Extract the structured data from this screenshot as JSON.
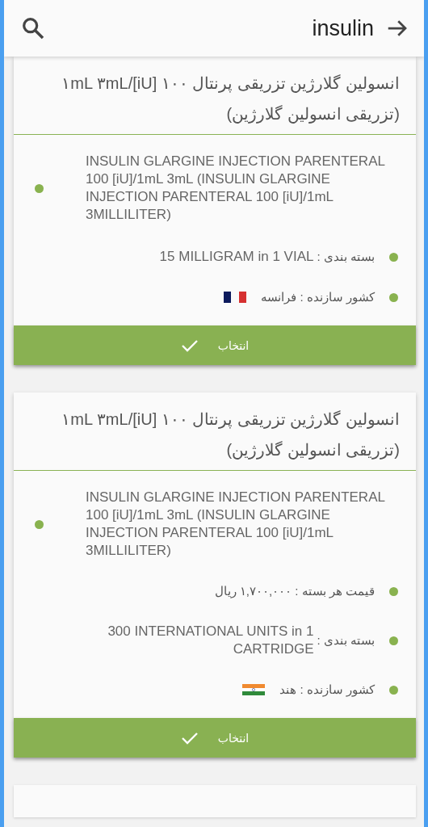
{
  "search": {
    "value": "insulin"
  },
  "results": [
    {
      "title": "انسولین گلارژین تزریقی پرنتال ۱۰۰ [iU]/۱mL ۳mL (تزریقی انسولین گلارژین)",
      "rows": [
        {
          "kind": "description",
          "text": "INSULIN GLARGINE INJECTION PARENTERAL 100 [iU]/1mL 3mL (INSULIN GLARGINE INJECTION PARENTERAL 100 [iU]/1mL 3MILLILITER)"
        },
        {
          "kind": "packaging",
          "label": "بسته بندی :",
          "text": "15 MILLIGRAM in 1 VIAL"
        },
        {
          "kind": "country",
          "text": "کشور سازنده : فرانسه",
          "flag": {
            "kind": "france"
          }
        }
      ],
      "button": "انتخاب"
    },
    {
      "title": "انسولین گلارژین تزریقی پرنتال ۱۰۰ [iU]/۱mL ۳mL (تزریقی انسولین گلارژین)",
      "rows": [
        {
          "kind": "description",
          "text": "INSULIN GLARGINE INJECTION PARENTERAL 100 [iU]/1mL 3mL (INSULIN GLARGINE INJECTION PARENTERAL 100 [iU]/1mL 3MILLILITER)"
        },
        {
          "kind": "price",
          "text": "قیمت هر بسته : ۱,۷۰۰,۰۰۰ ریال"
        },
        {
          "kind": "packaging",
          "label": "بسته بندی :",
          "text": "300 INTERNATIONAL UNITS in 1 CARTRIDGE"
        },
        {
          "kind": "country",
          "text": "کشور سازنده : هند",
          "flag": {
            "kind": "india"
          }
        }
      ],
      "button": "انتخاب"
    }
  ]
}
